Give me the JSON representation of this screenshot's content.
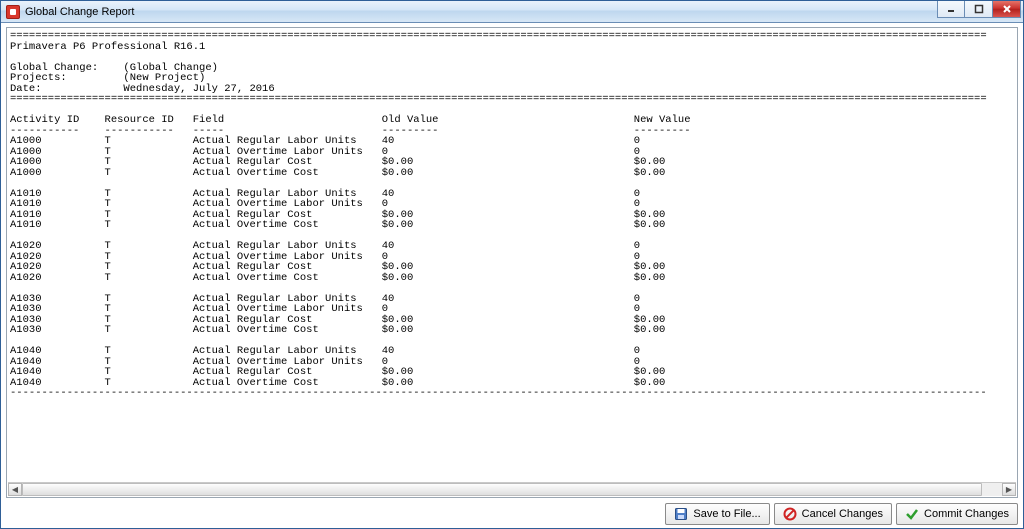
{
  "window": {
    "title": "Global Change Report"
  },
  "report": {
    "app_header": "Primavera P6 Professional R16.1",
    "meta_labels": {
      "global_change": "Global Change:",
      "projects": "Projects:",
      "date": "Date:"
    },
    "meta_values": {
      "global_change": "(Global Change)",
      "projects": "(New Project)",
      "date": "Wednesday, July 27, 2016"
    },
    "columns": {
      "activity_id": "Activity ID",
      "resource_id": "Resource ID",
      "field": "Field",
      "old_value": "Old Value",
      "new_value": "New Value"
    },
    "groups": [
      {
        "rows": [
          {
            "activity_id": "A1000",
            "resource_id": "T",
            "field": "Actual Regular Labor Units",
            "old": "40",
            "new": "0"
          },
          {
            "activity_id": "A1000",
            "resource_id": "T",
            "field": "Actual Overtime Labor Units",
            "old": "0",
            "new": "0"
          },
          {
            "activity_id": "A1000",
            "resource_id": "T",
            "field": "Actual Regular Cost",
            "old": "$0.00",
            "new": "$0.00"
          },
          {
            "activity_id": "A1000",
            "resource_id": "T",
            "field": "Actual Overtime Cost",
            "old": "$0.00",
            "new": "$0.00"
          }
        ]
      },
      {
        "rows": [
          {
            "activity_id": "A1010",
            "resource_id": "T",
            "field": "Actual Regular Labor Units",
            "old": "40",
            "new": "0"
          },
          {
            "activity_id": "A1010",
            "resource_id": "T",
            "field": "Actual Overtime Labor Units",
            "old": "0",
            "new": "0"
          },
          {
            "activity_id": "A1010",
            "resource_id": "T",
            "field": "Actual Regular Cost",
            "old": "$0.00",
            "new": "$0.00"
          },
          {
            "activity_id": "A1010",
            "resource_id": "T",
            "field": "Actual Overtime Cost",
            "old": "$0.00",
            "new": "$0.00"
          }
        ]
      },
      {
        "rows": [
          {
            "activity_id": "A1020",
            "resource_id": "T",
            "field": "Actual Regular Labor Units",
            "old": "40",
            "new": "0"
          },
          {
            "activity_id": "A1020",
            "resource_id": "T",
            "field": "Actual Overtime Labor Units",
            "old": "0",
            "new": "0"
          },
          {
            "activity_id": "A1020",
            "resource_id": "T",
            "field": "Actual Regular Cost",
            "old": "$0.00",
            "new": "$0.00"
          },
          {
            "activity_id": "A1020",
            "resource_id": "T",
            "field": "Actual Overtime Cost",
            "old": "$0.00",
            "new": "$0.00"
          }
        ]
      },
      {
        "rows": [
          {
            "activity_id": "A1030",
            "resource_id": "T",
            "field": "Actual Regular Labor Units",
            "old": "40",
            "new": "0"
          },
          {
            "activity_id": "A1030",
            "resource_id": "T",
            "field": "Actual Overtime Labor Units",
            "old": "0",
            "new": "0"
          },
          {
            "activity_id": "A1030",
            "resource_id": "T",
            "field": "Actual Regular Cost",
            "old": "$0.00",
            "new": "$0.00"
          },
          {
            "activity_id": "A1030",
            "resource_id": "T",
            "field": "Actual Overtime Cost",
            "old": "$0.00",
            "new": "$0.00"
          }
        ]
      },
      {
        "rows": [
          {
            "activity_id": "A1040",
            "resource_id": "T",
            "field": "Actual Regular Labor Units",
            "old": "40",
            "new": "0"
          },
          {
            "activity_id": "A1040",
            "resource_id": "T",
            "field": "Actual Overtime Labor Units",
            "old": "0",
            "new": "0"
          },
          {
            "activity_id": "A1040",
            "resource_id": "T",
            "field": "Actual Regular Cost",
            "old": "$0.00",
            "new": "$0.00"
          },
          {
            "activity_id": "A1040",
            "resource_id": "T",
            "field": "Actual Overtime Cost",
            "old": "$0.00",
            "new": "$0.00"
          }
        ]
      }
    ]
  },
  "buttons": {
    "save": "Save to File...",
    "cancel": "Cancel Changes",
    "commit": "Commit Changes"
  }
}
